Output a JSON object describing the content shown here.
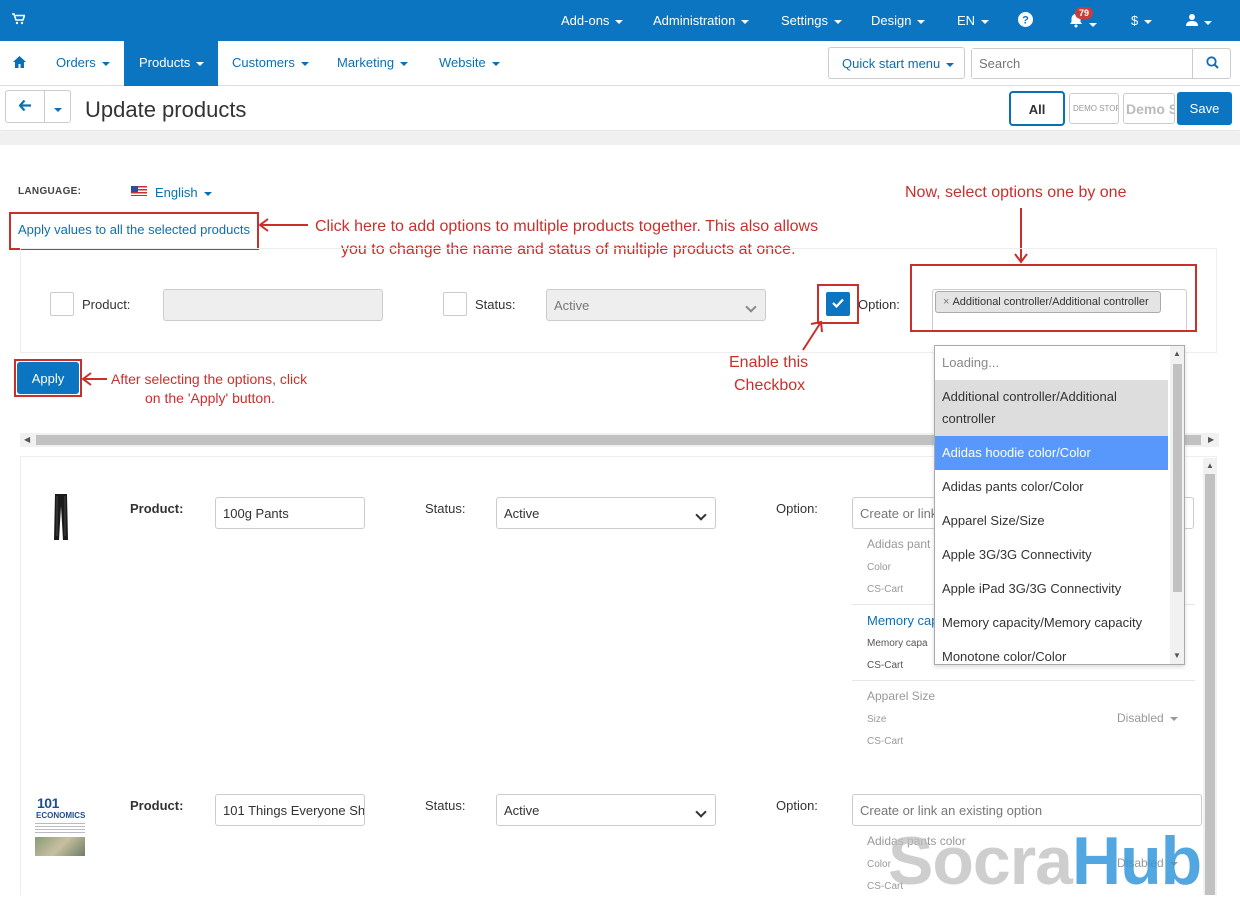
{
  "topbar": {
    "menus": [
      "Add-ons",
      "Administration",
      "Settings",
      "Design",
      "EN"
    ],
    "notification_count": "79",
    "currency": "$"
  },
  "nav": {
    "items": [
      "Orders",
      "Products",
      "Customers",
      "Marketing",
      "Website"
    ],
    "active": "Products",
    "quick_start": "Quick start menu",
    "search_placeholder": "Search"
  },
  "titlebar": {
    "title": "Update products",
    "all_label": "All",
    "demo_small": "DEMO STORE",
    "demo_big": "Demo Store",
    "save_label": "Save"
  },
  "language": {
    "label": "LANGUAGE:",
    "value": "English"
  },
  "bulk": {
    "apply_link": "Apply values to all the selected products",
    "product_label": "Product:",
    "status_label": "Status:",
    "status_value": "Active",
    "option_label": "Option:",
    "option_tag": "Additional controller/Additional controller",
    "apply_button": "Apply"
  },
  "annotations": {
    "click_here_1": "Click here to add options to multiple products together. This also allows",
    "click_here_2": "you to change the name and status of multiple products at once.",
    "select_options": "Now, select options one by one",
    "enable_1": "Enable this",
    "enable_2": "Checkbox",
    "after_1": "After selecting the options, click",
    "after_2": "on the 'Apply' button."
  },
  "dropdown": {
    "loading": "Loading...",
    "items": [
      "Additional controller/Additional",
      "controller",
      "Adidas hoodie color/Color",
      "Adidas pants color/Color",
      "Apparel Size/Size",
      "Apple 3G/3G Connectivity",
      "Apple iPad 3G/3G Connectivity",
      "Memory capacity/Memory capacity",
      "Monotone color/Color"
    ]
  },
  "products": [
    {
      "product_label": "Product:",
      "name": "100g Pants",
      "status_label": "Status:",
      "status": "Active",
      "option_label": "Option:",
      "option_placeholder": "Create or link",
      "options": [
        {
          "name": "Adidas pant",
          "type": "Color",
          "vendor": "CS-Cart"
        },
        {
          "name": "Memory cap",
          "type": "Memory capa",
          "vendor": "CS-Cart"
        },
        {
          "name": "Apparel Size",
          "type": "Size",
          "vendor": "CS-Cart",
          "state": "Disabled"
        }
      ]
    },
    {
      "product_label": "Product:",
      "name": "101 Things Everyone Sh",
      "status_label": "Status:",
      "status": "Active",
      "option_label": "Option:",
      "option_placeholder": "Create or link an existing option",
      "options": [
        {
          "name": "Adidas pants color",
          "type": "Color",
          "vendor": "CS-Cart",
          "state": "Disabled"
        }
      ],
      "image_text_1": "101",
      "image_text_2": "ECONOMICS"
    }
  ],
  "watermark": {
    "part1": "Socra",
    "part2": "Hub"
  },
  "colors": {
    "primary": "#0c75c1",
    "annotation": "#c9302c",
    "highlight": "#5897fb"
  }
}
